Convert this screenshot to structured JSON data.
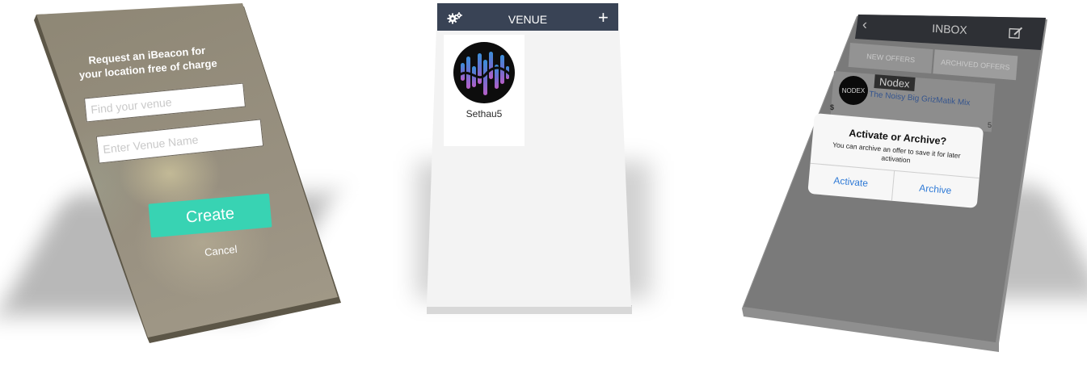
{
  "create_screen": {
    "prompt": "Request an iBeacon for your location free of charge",
    "find_venue_placeholder": "Find your venue",
    "venue_name_placeholder": "Enter Venue Name",
    "create_label": "Create",
    "cancel_label": "Cancel",
    "accent_color": "#38d3b3"
  },
  "venue_screen": {
    "title": "VENUE",
    "settings_icon": "gears-icon",
    "add_icon": "plus-icon",
    "header_color": "#394355",
    "venues": [
      {
        "name": "Sethau5",
        "icon": "waveform-avatar"
      }
    ]
  },
  "inbox_screen": {
    "title": "INBOX",
    "back_icon": "chevron-left-icon",
    "compose_icon": "compose-icon",
    "tabs": [
      "NEW OFFERS",
      "ARCHIVED OFFERS"
    ],
    "offer": {
      "brand_logo_text": "NODEX",
      "brand": "Nodex",
      "title": "The Noisy Big GrizMatik Mix",
      "price_prefix": "$",
      "trailing_number": "5"
    },
    "dialog": {
      "title": "Activate or Archive?",
      "message": "You can archive an offer to save it for later activation",
      "activate_label": "Activate",
      "archive_label": "Archive",
      "button_color": "#2f7ad6"
    }
  }
}
